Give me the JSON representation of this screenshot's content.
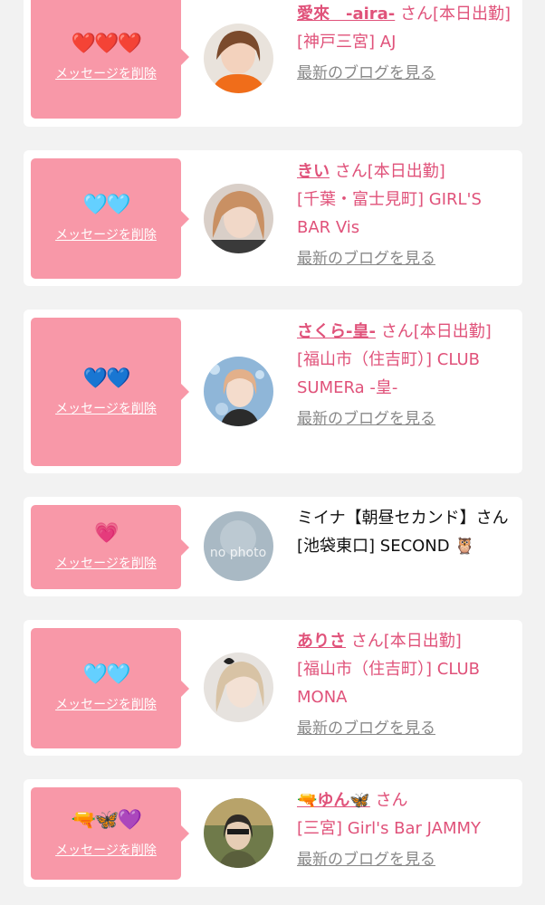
{
  "common": {
    "delete_label": "メッセージを削除",
    "blog_label": "最新のブログを見る",
    "san": "さん"
  },
  "colors": {
    "pink_panel": "#f898a8",
    "accent_text": "#e0527a",
    "background": "#f2f2f2"
  },
  "cards": [
    {
      "emoji": "❤️❤️❤️",
      "name": "愛來　-aira-",
      "status": "[本日出勤]",
      "shop": "[神戸三宮] AJ"
    },
    {
      "emoji": "🩵🩵",
      "name": "きい",
      "status": "[本日出勤]",
      "shop": "[千葉・富士見町] GIRL'S BAR Vis"
    },
    {
      "emoji": "💙💙",
      "name": "さくら-皇-",
      "status": "[本日出勤]",
      "shop": "[福山市（住吉町）] CLUB SUMERa -皇-"
    },
    {
      "emoji": "💗",
      "name": "ミイナ【朝昼セカンド】",
      "status": "",
      "shop": "[池袋東口] SECOND 🦉",
      "avatar_text": "no photo"
    },
    {
      "emoji": "🩵🩵",
      "name": "ありさ",
      "status": "[本日出勤]",
      "shop": "[福山市（住吉町）] CLUB MONA"
    },
    {
      "emoji": "🔫🦋💜",
      "name": "🔫ゆん🦋",
      "status": "",
      "shop": "[三宮] Girl's Bar JAMMY"
    }
  ]
}
